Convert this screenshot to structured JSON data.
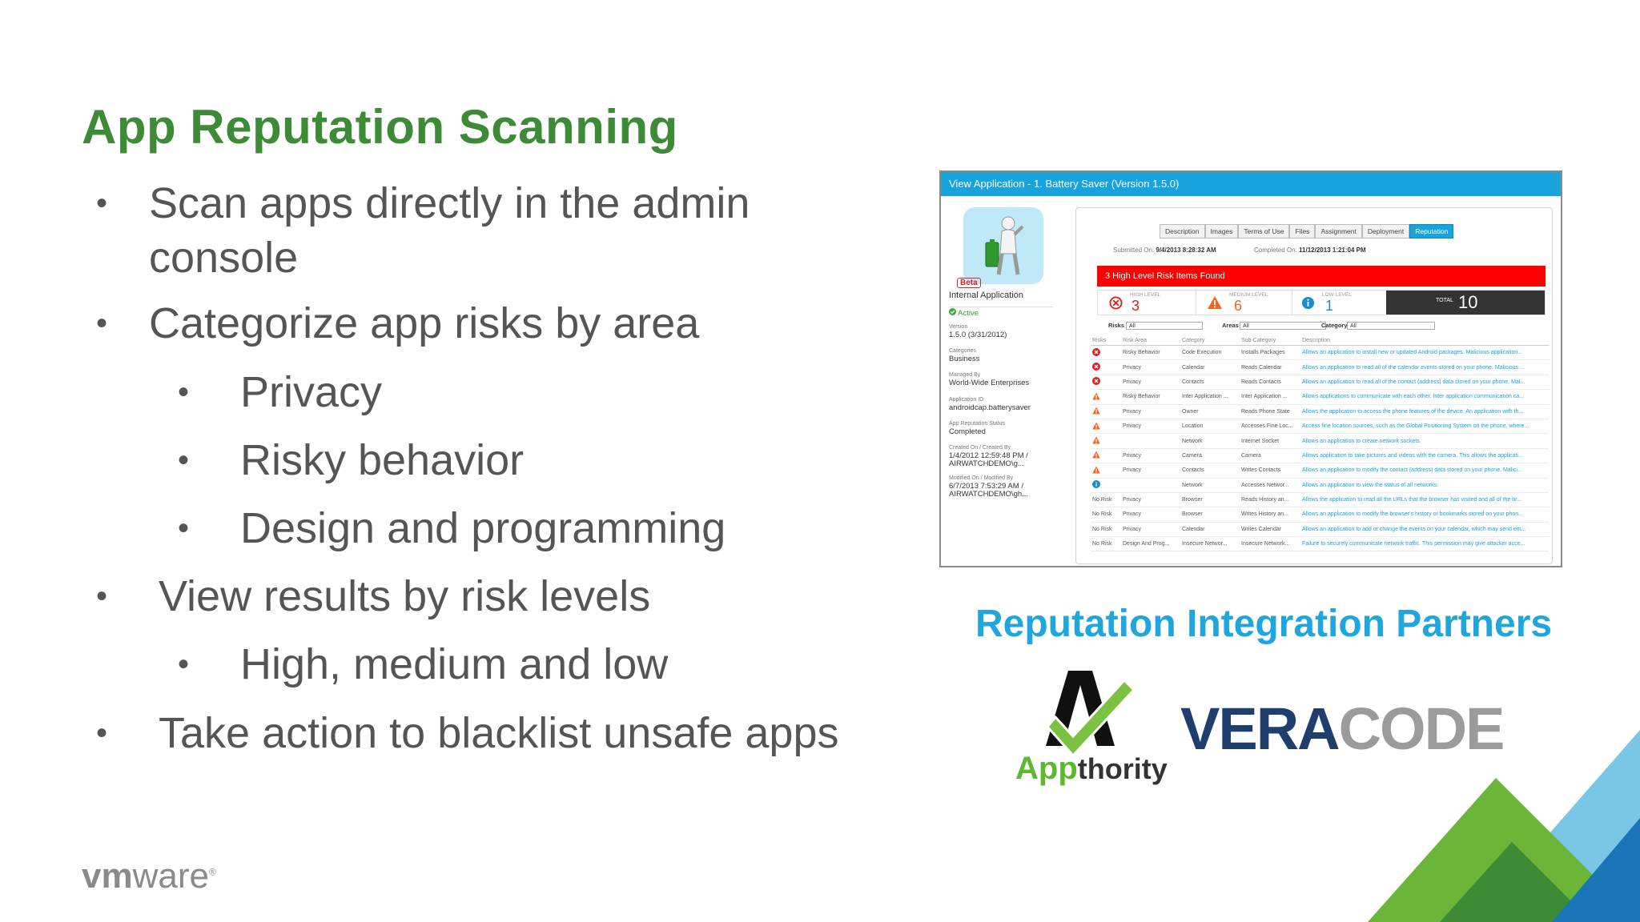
{
  "title": "App Reputation Scanning",
  "bullets": [
    {
      "level": 1,
      "lines": [
        "Scan apps directly in the admin",
        "console"
      ]
    },
    {
      "level": 1,
      "lines": [
        "Categorize app risks by area"
      ]
    },
    {
      "level": 2,
      "lines": [
        "Privacy"
      ]
    },
    {
      "level": 2,
      "lines": [
        "Risky behavior"
      ]
    },
    {
      "level": 2,
      "lines": [
        "Design and programming"
      ]
    },
    {
      "level": 1,
      "lines": [
        "View results by risk levels"
      ]
    },
    {
      "level": 2,
      "lines": [
        "High, medium and low"
      ]
    },
    {
      "level": 1,
      "lines": [
        "Take action to blacklist unsafe apps"
      ]
    }
  ],
  "screenshot": {
    "window_title": "View Application - 1. Battery Saver (Version 1.5.0)",
    "beta": "Beta",
    "app_type": "Internal Application",
    "status": "Active",
    "details": [
      {
        "label": "Version",
        "value": "1.5.0 (3/31/2012)"
      },
      {
        "label": "Categories",
        "value": "Business"
      },
      {
        "label": "Managed By",
        "value": "World-Wide Enterprises"
      },
      {
        "label": "Application ID",
        "value": "androidcap.batterysaver"
      },
      {
        "label": "App Reputation Status",
        "value": "Completed"
      },
      {
        "label": "Created On / Created By",
        "value": "1/4/2012 12:59:48 PM /",
        "value2": "AIRWATCHDEMO\\g..."
      },
      {
        "label": "Modified On / Modified By",
        "value": "6/7/2013 7:53:29 AM /",
        "value2": "AIRWATCHDEMO\\gh..."
      }
    ],
    "tabs": [
      "Description",
      "Images",
      "Terms of Use",
      "Files",
      "Assignment",
      "Deployment",
      "Reputation"
    ],
    "active_tab": "Reputation",
    "submitted_label": "Submitted On:",
    "submitted_value": "9/4/2013 8:28:32 AM",
    "completed_label": "Completed On:",
    "completed_value": "11/12/2013 1:21:04 PM",
    "alert": "3 High Level Risk Items Found",
    "levels": {
      "high_label": "HIGH LEVEL",
      "high": "3",
      "medium_label": "MEDIUM LEVEL",
      "medium": "6",
      "low_label": "LOW LEVEL",
      "low": "1",
      "total_label": "TOTAL",
      "total": "10"
    },
    "filters": {
      "risks_label": "Risks",
      "risks_value": "All",
      "areas_label": "Areas",
      "areas_value": "All",
      "category_label": "Category",
      "category_value": "All"
    },
    "columns": [
      "Risks",
      "Risk Area",
      "Category",
      "Sub-Category",
      "Description"
    ],
    "rows": [
      {
        "risk": "high",
        "area": "Risky Behavior",
        "category": "Code Execution",
        "sub": "Installs Packages",
        "desc": "Allows an application to install new or updated Android packages. Malicious application..."
      },
      {
        "risk": "high",
        "area": "Privacy",
        "category": "Calendar",
        "sub": "Reads Calendar",
        "desc": "Allows an application to read all of the calendar events stored on your phone. Malicious ..."
      },
      {
        "risk": "high",
        "area": "Privacy",
        "category": "Contacts",
        "sub": "Reads Contacts",
        "desc": "Allows an application to read all of the contact (address) data stored on your phone. Mal..."
      },
      {
        "risk": "medium",
        "area": "Risky Behavior",
        "category": "Inter Application ...",
        "sub": "Inter Application ...",
        "desc": "Allows applications to communicate with each other. Inter application communication ca..."
      },
      {
        "risk": "medium",
        "area": "Privacy",
        "category": "Owner",
        "sub": "Reads Phone State",
        "desc": "Allows the application to access the phone features of the device. An application with th..."
      },
      {
        "risk": "medium",
        "area": "Privacy",
        "category": "Location",
        "sub": "Accesses Fine Loc...",
        "desc": "Access fine location sources, such as the Global Positioning System on the phone, where..."
      },
      {
        "risk": "medium",
        "area": "",
        "category": "Network",
        "sub": "Internet Socket",
        "desc": "Allows an application to create network sockets."
      },
      {
        "risk": "medium",
        "area": "Privacy",
        "category": "Camera",
        "sub": "Camera",
        "desc": "Allows application to take pictures and videos with the camera. This allows the applicati..."
      },
      {
        "risk": "medium",
        "area": "Privacy",
        "category": "Contacts",
        "sub": "Writes Contacts",
        "desc": "Allows an application to modify the contact (address) data stored on your phone. Malici..."
      },
      {
        "risk": "low",
        "area": "",
        "category": "Network",
        "sub": "Accesses Networ...",
        "desc": "Allows an application to view the status of all networks."
      },
      {
        "risk": "No Risk",
        "area": "Privacy",
        "category": "Browser",
        "sub": "Reads History an...",
        "desc": "Allows the application to read all the URLs that the browser has visited and all of the br..."
      },
      {
        "risk": "No Risk",
        "area": "Privacy",
        "category": "Browser",
        "sub": "Writes History an...",
        "desc": "Allows an application to modify the browser's history or bookmarks stored on your phon..."
      },
      {
        "risk": "No Risk",
        "area": "Privacy",
        "category": "Calendar",
        "sub": "Writes Calendar",
        "desc": "Allows an application to add or change the events on your calendar, which may send em..."
      },
      {
        "risk": "No Risk",
        "area": "Design And Prog...",
        "category": "Insecure Networ...",
        "sub": "Insecure Network...",
        "desc": "Failure to securely communicate network traffic. This permission may give attacker acce..."
      }
    ]
  },
  "partners_heading": "Reputation Integration Partners",
  "appthority": {
    "first": "A",
    "rest": "pp",
    "tail": "thority"
  },
  "veracode": {
    "a": "VERA",
    "b": "CODE"
  },
  "vmware": {
    "vm": "vm",
    "ware": "ware",
    "reg": "®"
  },
  "colors": {
    "title": "#3d8b37",
    "partners": "#1fa7dd",
    "alert": "#ff0000",
    "header": "#19a3dc",
    "high": "#e02020",
    "medium": "#f26522",
    "low": "#1a8ccf"
  }
}
